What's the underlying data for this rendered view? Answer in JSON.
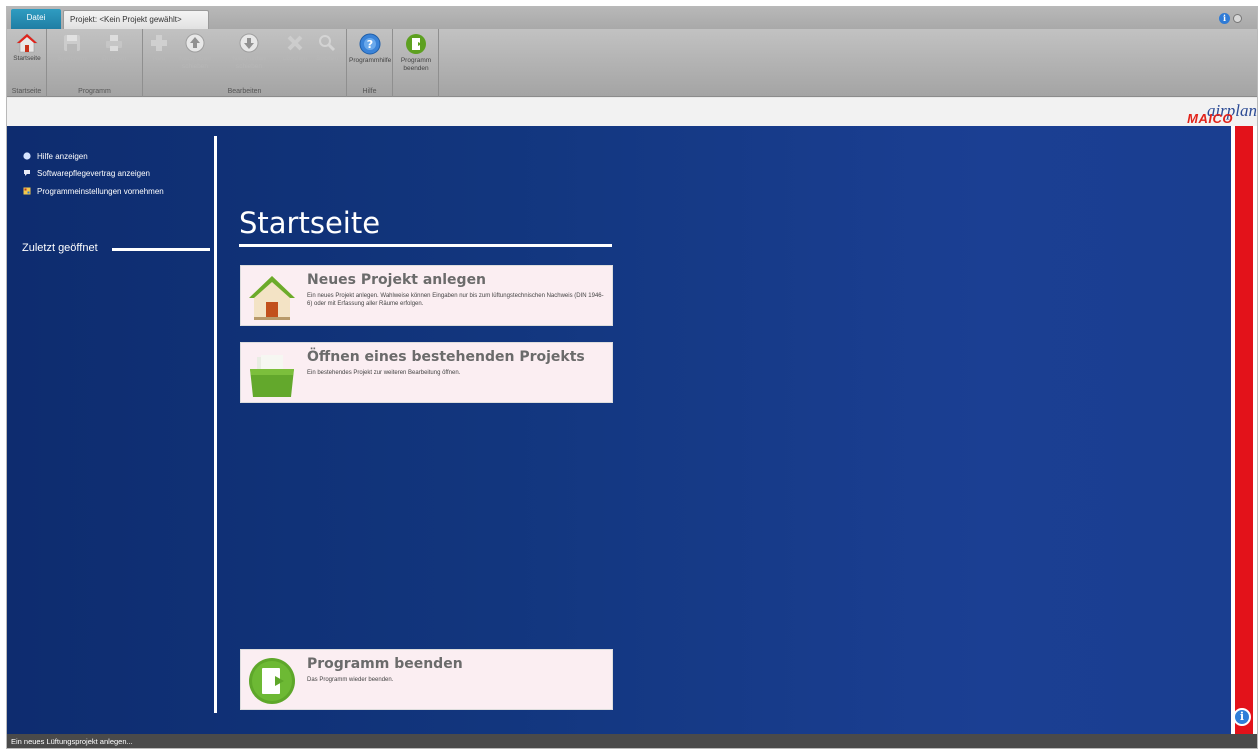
{
  "tabs": {
    "file": "Datei",
    "project": "Projekt: <Kein Projekt gewählt>"
  },
  "ribbon": {
    "groups": {
      "startseite": "Startseite",
      "programm": "Programm",
      "bearbeiten": "Bearbeiten",
      "hilfe": "Hilfe"
    },
    "buttons": {
      "startseite": "Startseite",
      "speichern": "Speichern",
      "drucken": "Drucken",
      "neu": "Neu",
      "nach_oben_line1": "Nach oben",
      "nach_oben_line2": "schieben",
      "nach_unten_line1": "Nach unten",
      "nach_unten_line2": "schieben",
      "loeschen": "Löschen",
      "suchen": "Suchen",
      "programmhilfe": "Programmhilfe",
      "beenden_line1": "Programm",
      "beenden_line2": "beenden"
    }
  },
  "logo": {
    "product": "airplan",
    "brand": "MAICO"
  },
  "sidebar": {
    "links": [
      {
        "label": "Hilfe anzeigen",
        "icon": "help-circle-icon"
      },
      {
        "label": "Softwarepflegevertrag anzeigen",
        "icon": "speech-bubble-icon"
      },
      {
        "label": "Programmeinstellungen vornehmen",
        "icon": "settings-icon"
      }
    ],
    "recent_label": "Zuletzt geöffnet"
  },
  "main": {
    "title": "Startseite",
    "cards": [
      {
        "title": "Neues Projekt anlegen",
        "description": "Ein neues Projekt anlegen. Wahlweise können Eingaben nur bis zum lüftungstechnischen Nachweis (DIN 1946-6) oder mit Erfassung aller Räume erfolgen.",
        "icon": "house-icon"
      },
      {
        "title": "Öffnen eines bestehenden Projekts",
        "description": "Ein bestehendes Projekt zur weiteren Bearbeitung öffnen.",
        "icon": "folder-icon"
      },
      {
        "title": "Programm beenden",
        "description": "Das Programm wieder beenden.",
        "icon": "exit-icon"
      }
    ]
  },
  "status": {
    "text": "Ein neues Lüftungsprojekt anlegen..."
  },
  "colors": {
    "main_bg": "#12367e",
    "accent_red": "#e3121a",
    "card_bg": "#fbeef2",
    "file_tab": "#2f9cc1"
  }
}
